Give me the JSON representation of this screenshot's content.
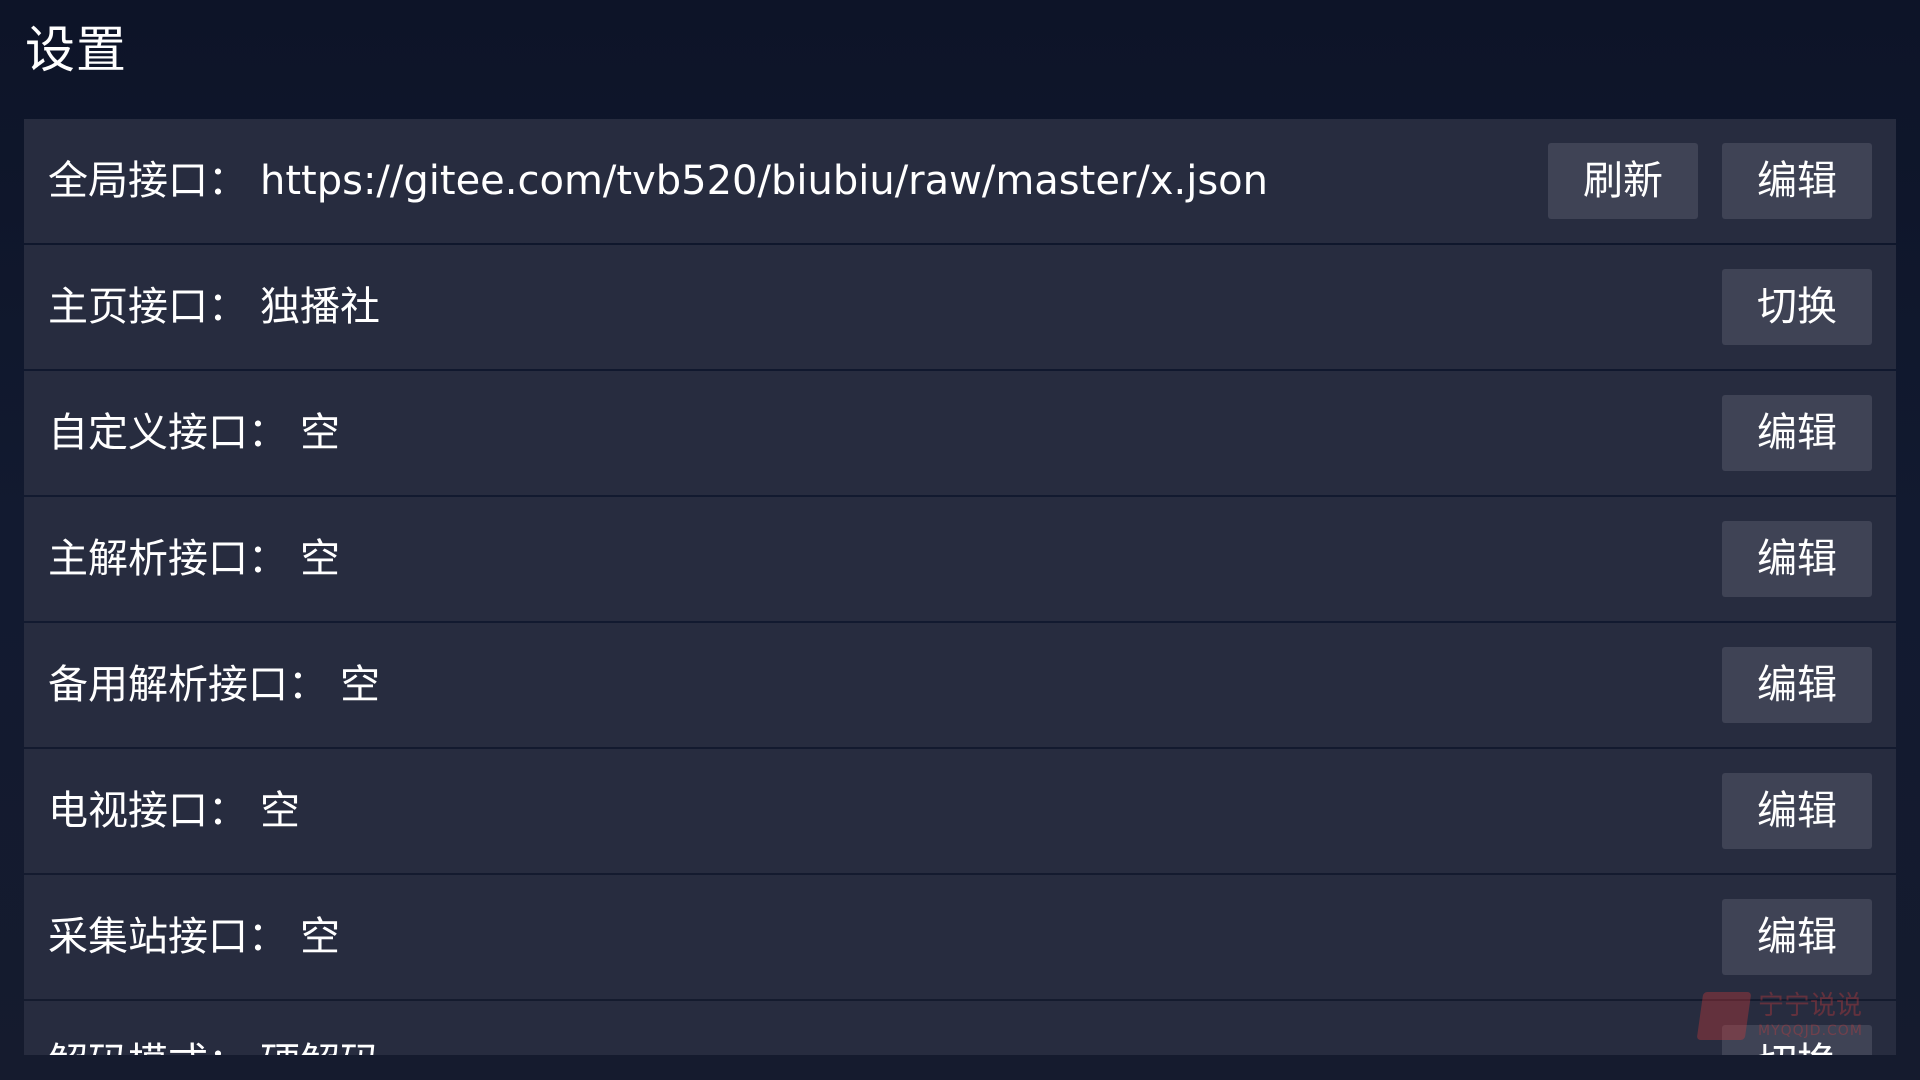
{
  "header": {
    "title": "设置"
  },
  "settings": {
    "rows": [
      {
        "label": "全局接口：",
        "value": "https://gitee.com/tvb520/biubiu/raw/master/x.json",
        "buttons": [
          "编辑",
          "刷新"
        ]
      },
      {
        "label": "主页接口：",
        "value": "独播社",
        "buttons": [
          "切换"
        ]
      },
      {
        "label": "自定义接口：",
        "value": "空",
        "buttons": [
          "编辑"
        ]
      },
      {
        "label": "主解析接口：",
        "value": "空",
        "buttons": [
          "编辑"
        ]
      },
      {
        "label": "备用解析接口：",
        "value": "空",
        "buttons": [
          "编辑"
        ]
      },
      {
        "label": "电视接口：",
        "value": "空",
        "buttons": [
          "编辑"
        ]
      },
      {
        "label": "采集站接口：",
        "value": "空",
        "buttons": [
          "编辑"
        ]
      },
      {
        "label": "解码模式：",
        "value": "硬解码",
        "buttons": [
          "切换"
        ]
      }
    ]
  },
  "watermark": {
    "text": "宁宁说说",
    "subtext": "MYQQJD.COM"
  }
}
